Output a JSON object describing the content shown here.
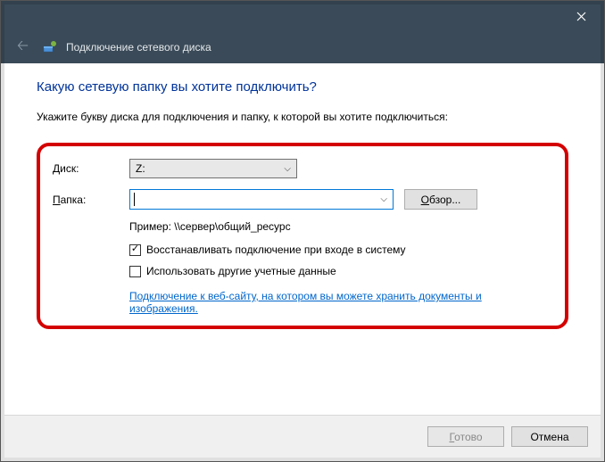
{
  "window": {
    "title": "Подключение сетевого диска"
  },
  "heading": "Какую сетевую папку вы хотите подключить?",
  "instruction": "Укажите букву диска для подключения и папку, к которой вы хотите подключиться:",
  "form": {
    "drive_label": "Диск:",
    "drive_value": "Z:",
    "folder_label": "Папка:",
    "folder_value": "",
    "browse_label": "Обзор...",
    "example": "Пример: \\\\сервер\\общий_ресурс",
    "checkbox_reconnect": "Восстанавливать подключение при входе в систему",
    "checkbox_reconnect_checked": true,
    "checkbox_credentials": "Использовать другие учетные данные",
    "checkbox_credentials_checked": false,
    "link_text": "Подключение к веб-сайту, на котором вы можете хранить документы и изображения."
  },
  "footer": {
    "finish": "Готово",
    "cancel": "Отмена"
  }
}
